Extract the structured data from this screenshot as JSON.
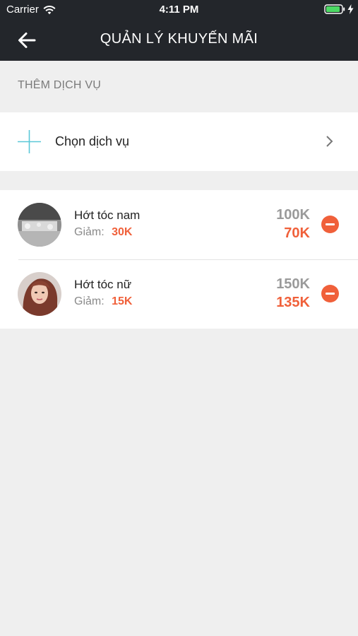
{
  "status_bar": {
    "carrier": "Carrier",
    "time": "4:11 PM"
  },
  "header": {
    "title": "QUẢN LÝ KHUYẾN MÃI",
    "back_icon": "arrow-left-icon"
  },
  "add_service": {
    "section_label": "THÊM DỊCH VỤ",
    "select_label": "Chọn dịch vụ",
    "plus_icon": "plus-icon",
    "chevron_icon": "chevron-right-icon"
  },
  "services": [
    {
      "name": "Hớt tóc nam",
      "discount_label": "Giảm:",
      "discount": "30K",
      "old_price": "100K",
      "new_price": "70K"
    },
    {
      "name": "Hớt tóc nữ",
      "discount_label": "Giảm:",
      "discount": "15K",
      "old_price": "150K",
      "new_price": "135K"
    }
  ],
  "colors": {
    "header_bg": "#23262b",
    "accent": "#f0603a",
    "plus_icon": "#5ac8d8",
    "page_bg": "#efefef"
  }
}
